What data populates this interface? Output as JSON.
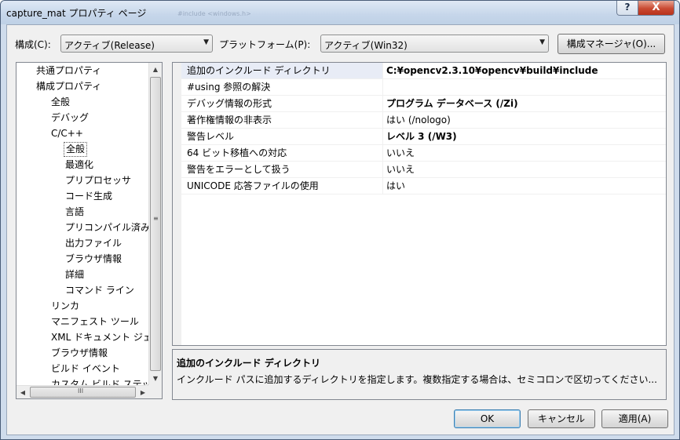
{
  "window": {
    "title": "capture_mat プロパティ ページ",
    "background_hint": "#include <windows.h>",
    "help_label": "?",
    "close_label": "X"
  },
  "config": {
    "label": "構成(C):",
    "value": "アクティブ(Release)",
    "platform_label": "プラットフォーム(P):",
    "platform_value": "アクティブ(Win32)",
    "manager_button": "構成マネージャ(O)..."
  },
  "tree": {
    "items": [
      {
        "label": "共通プロパティ",
        "indent": 0
      },
      {
        "label": "構成プロパティ",
        "indent": 0
      },
      {
        "label": "全般",
        "indent": 1
      },
      {
        "label": "デバッグ",
        "indent": 1
      },
      {
        "label": "C/C++",
        "indent": 1
      },
      {
        "label": "全般",
        "indent": 2,
        "selected": true
      },
      {
        "label": "最適化",
        "indent": 2
      },
      {
        "label": "プリプロセッサ",
        "indent": 2
      },
      {
        "label": "コード生成",
        "indent": 2
      },
      {
        "label": "言語",
        "indent": 2
      },
      {
        "label": "プリコンパイル済み",
        "indent": 2
      },
      {
        "label": "出力ファイル",
        "indent": 2
      },
      {
        "label": "ブラウザ情報",
        "indent": 2
      },
      {
        "label": "詳細",
        "indent": 2
      },
      {
        "label": "コマンド ライン",
        "indent": 2
      },
      {
        "label": "リンカ",
        "indent": 1
      },
      {
        "label": "マニフェスト ツール",
        "indent": 1
      },
      {
        "label": "XML ドキュメント ジェ",
        "indent": 1
      },
      {
        "label": "ブラウザ情報",
        "indent": 1
      },
      {
        "label": "ビルド イベント",
        "indent": 1
      },
      {
        "label": "カスタム ビルド ステッ",
        "indent": 1
      }
    ]
  },
  "properties": {
    "rows": [
      {
        "name": "追加のインクルード ディレクトリ",
        "value": "C:¥opencv2.3.10¥opencv¥build¥include",
        "bold": true,
        "selected": true
      },
      {
        "name": "#using 参照の解決",
        "value": "",
        "bold": false
      },
      {
        "name": "デバッグ情報の形式",
        "value": "プログラム データベース (/Zi)",
        "bold": true
      },
      {
        "name": "著作権情報の非表示",
        "value": "はい (/nologo)",
        "bold": false
      },
      {
        "name": "警告レベル",
        "value": "レベル 3 (/W3)",
        "bold": true
      },
      {
        "name": "64 ビット移植への対応",
        "value": "いいえ",
        "bold": false
      },
      {
        "name": "警告をエラーとして扱う",
        "value": "いいえ",
        "bold": false
      },
      {
        "name": "UNICODE 応答ファイルの使用",
        "value": "はい",
        "bold": false
      }
    ]
  },
  "description": {
    "title": "追加のインクルード ディレクトリ",
    "text": "インクルード パスに追加するディレクトリを指定します。複数指定する場合は、セミコロンで区切ってください..."
  },
  "buttons": {
    "ok": "OK",
    "cancel": "キャンセル",
    "apply": "適用(A)"
  },
  "colors": {
    "title_bar": "#c6d6ea",
    "close_button": "#c94a32",
    "selected_row": "#e8ecf6"
  }
}
